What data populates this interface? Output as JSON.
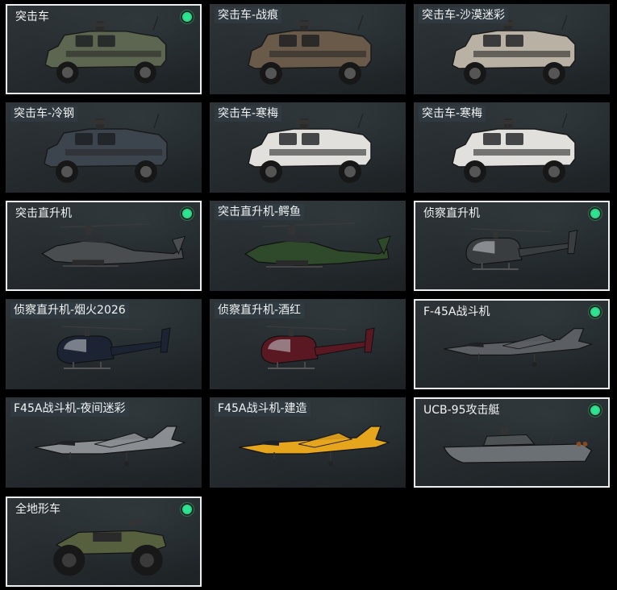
{
  "vehicles": [
    {
      "name": "突击车",
      "owned": true,
      "icon": "armored-car-icon"
    },
    {
      "name": "突击车-战痕",
      "owned": false,
      "icon": "armored-car-icon"
    },
    {
      "name": "突击车-沙漠迷彩",
      "owned": false,
      "icon": "armored-car-icon"
    },
    {
      "name": "突击车-冷钢",
      "owned": false,
      "icon": "armored-car-icon"
    },
    {
      "name": "突击车-寒梅",
      "owned": false,
      "icon": "armored-car-icon"
    },
    {
      "name": "突击车-寒梅",
      "owned": false,
      "icon": "armored-car-icon"
    },
    {
      "name": "突击直升机",
      "owned": true,
      "icon": "attack-helicopter-icon"
    },
    {
      "name": "突击直升机-鳄鱼",
      "owned": false,
      "icon": "attack-helicopter-icon"
    },
    {
      "name": "侦察直升机",
      "owned": true,
      "icon": "scout-helicopter-icon"
    },
    {
      "name": "侦察直升机-烟火2026",
      "owned": false,
      "icon": "scout-helicopter-icon"
    },
    {
      "name": "侦察直升机-酒红",
      "owned": false,
      "icon": "scout-helicopter-icon"
    },
    {
      "name": "F-45A战斗机",
      "owned": true,
      "icon": "fighter-jet-icon"
    },
    {
      "name": "F45A战斗机-夜间迷彩",
      "owned": false,
      "icon": "fighter-jet-icon"
    },
    {
      "name": "F45A战斗机-建造",
      "owned": false,
      "icon": "fighter-jet-icon"
    },
    {
      "name": "UCB-95攻击艇",
      "owned": true,
      "icon": "attack-boat-icon"
    },
    {
      "name": "全地形车",
      "owned": true,
      "icon": "atv-icon"
    }
  ],
  "colors": {
    "owned_indicator": "#3bd08a",
    "owned_border": "#ecefef",
    "car_green": "#5d6650",
    "car_scarred": "#6a5a4a",
    "car_desert": "#b9b1a3",
    "car_steel": "#3c444e",
    "car_plum": "#e2e0dc",
    "heli_gray": "#4a4d50",
    "heli_croc": "#2f4a2a",
    "scout_gray": "#3a3d40",
    "scout_blue": "#1c2433",
    "scout_wine": "#5a1822",
    "jet_gray": "#5b5f63",
    "jet_night": "#8a8e92",
    "jet_yellow": "#e5a51c",
    "boat_gray": "#6b7074",
    "atv_green": "#56603f"
  }
}
